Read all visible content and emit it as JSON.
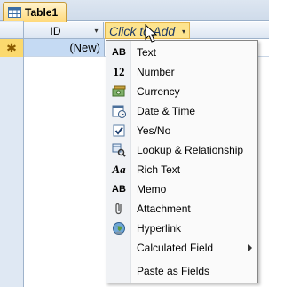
{
  "tab": {
    "title": "Table1",
    "icon": "table-icon"
  },
  "columns": {
    "id_header": "ID",
    "add_header": "Click to Add",
    "dropdown_arrow": "▾"
  },
  "new_record": {
    "selector_symbol": "✱",
    "id_value": "(New)"
  },
  "menu": {
    "items": [
      {
        "label": "Text",
        "icon": "text-icon",
        "glyph": "AB"
      },
      {
        "label": "Number",
        "icon": "number-icon",
        "glyph": "12"
      },
      {
        "label": "Currency",
        "icon": "currency-icon",
        "glyph": ""
      },
      {
        "label": "Date & Time",
        "icon": "calendar-icon",
        "glyph": ""
      },
      {
        "label": "Yes/No",
        "icon": "checkbox-icon",
        "glyph": ""
      },
      {
        "label": "Lookup & Relationship",
        "icon": "lookup-icon",
        "glyph": ""
      },
      {
        "label": "Rich Text",
        "icon": "rich-text-icon",
        "glyph": "Aa"
      },
      {
        "label": "Memo",
        "icon": "memo-icon",
        "glyph": "AB"
      },
      {
        "label": "Attachment",
        "icon": "paperclip-icon",
        "glyph": ""
      },
      {
        "label": "Hyperlink",
        "icon": "globe-icon",
        "glyph": ""
      },
      {
        "label": "Calculated Field",
        "icon": "",
        "glyph": ""
      },
      {
        "label": "Paste as Fields",
        "icon": "",
        "glyph": ""
      }
    ]
  },
  "colors": {
    "header_highlight": "#fde48e",
    "selected_cell": "#c5daf3",
    "record_selector": "#fbd96e"
  }
}
